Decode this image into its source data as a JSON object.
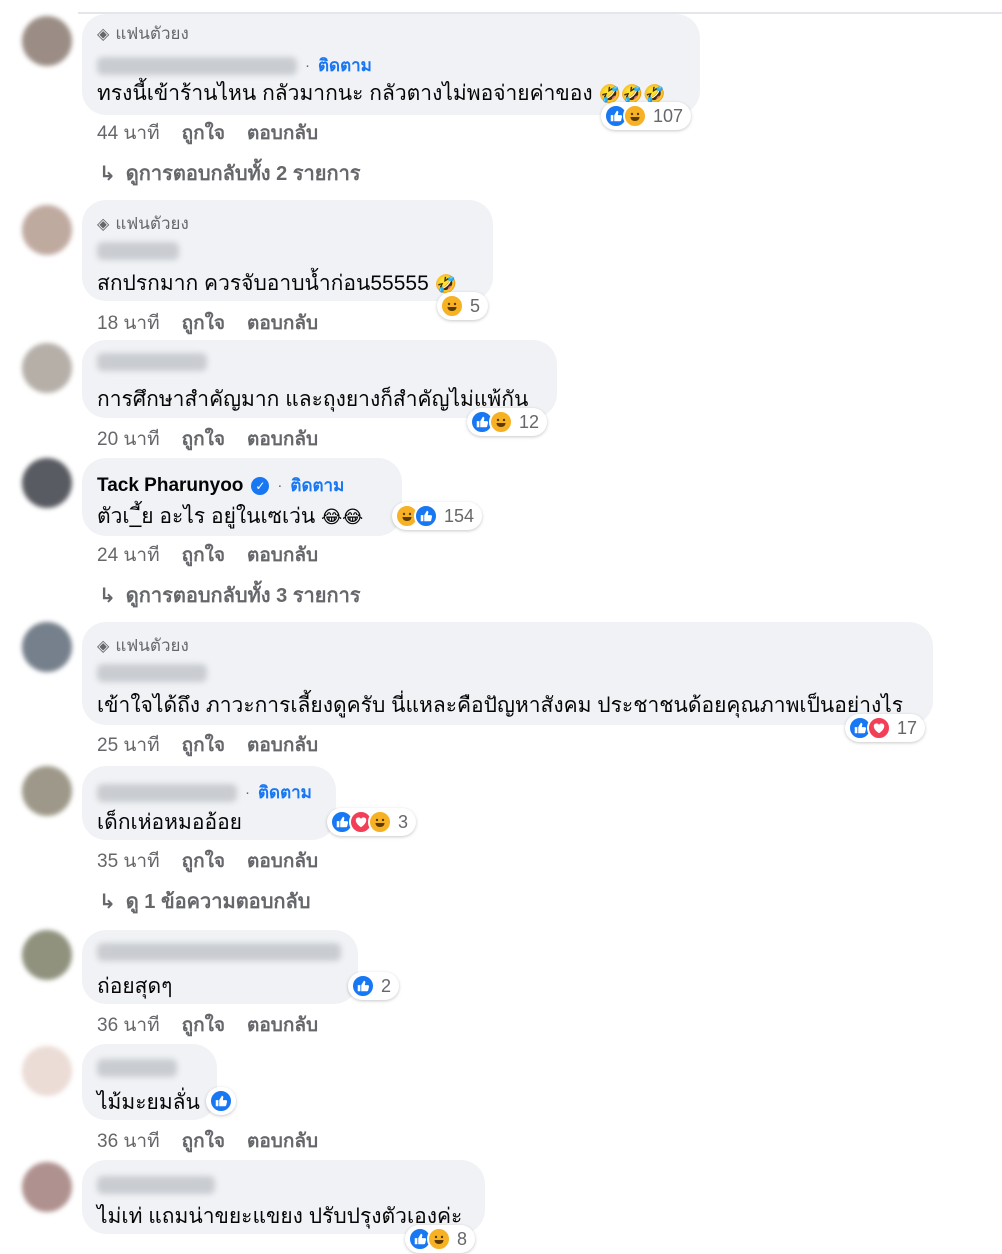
{
  "badges": {
    "top_fan": "แฟนตัวยง",
    "follow": "ติดตาม"
  },
  "actions": {
    "like": "ถูกใจ",
    "reply": "ตอบกลับ"
  },
  "comments": [
    {
      "text": "ทรงนี้เข้าร้านไหน กลัวมากนะ กลัวตางไม่พอจ่ายค่าของ",
      "emoji": "🤣🤣🤣",
      "time": "44 นาที",
      "reactions": [
        "like",
        "haha"
      ],
      "count": "107",
      "view_replies": "ดูการตอบกลับทั้ง 2 รายการ"
    },
    {
      "text": "สกปรกมาก ควรจับอาบน้ำก่อน55555",
      "emoji": "🤣",
      "time": "18 นาที",
      "reactions": [
        "haha"
      ],
      "count": "5"
    },
    {
      "text": "การศึกษาสำคัญมาก และถุงยางก็สำคัญไม่แพ้กัน",
      "emoji": "",
      "time": "20 นาที",
      "reactions": [
        "like",
        "haha"
      ],
      "count": "12"
    },
    {
      "name": "Tack Pharunyoo",
      "text": "ตัวเ_ี้ย อะไร อยู่ในเซเว่น",
      "emoji": "😂😂",
      "time": "24 นาที",
      "reactions": [
        "haha",
        "like"
      ],
      "count": "154",
      "view_replies": "ดูการตอบกลับทั้ง 3 รายการ"
    },
    {
      "text": "เข้าใจได้ถึง ภาวะการเลี้ยงดูครับ นี่แหละคือปัญหาสังคม ประชาชนด้อยคุณภาพเป็นอย่างไร",
      "emoji": "",
      "time": "25 นาที",
      "reactions": [
        "like",
        "love"
      ],
      "count": "17"
    },
    {
      "text": "เด็กเห่อหมออ้อย",
      "emoji": "",
      "time": "35 นาที",
      "reactions": [
        "like",
        "love",
        "haha"
      ],
      "count": "3",
      "view_replies": "ดู 1 ข้อความตอบกลับ"
    },
    {
      "text": "ถ่อยสุดๆ",
      "emoji": "",
      "time": "36 นาที",
      "reactions": [
        "like"
      ],
      "count": "2"
    },
    {
      "text": "ไม้มะยมลั่น",
      "emoji": "",
      "time": "36 นาที",
      "reactions": [
        "like"
      ],
      "count": ""
    },
    {
      "text": "ไม่เท่ แถมน่าขยะแขยง ปรับปรุงตัวเองค่ะ",
      "emoji": "",
      "time": "",
      "reactions": [
        "like",
        "haha"
      ],
      "count": "8"
    }
  ],
  "colors": {
    "accent": "#1877f2",
    "bubble": "#f0f2f5",
    "meta": "#65676b"
  }
}
